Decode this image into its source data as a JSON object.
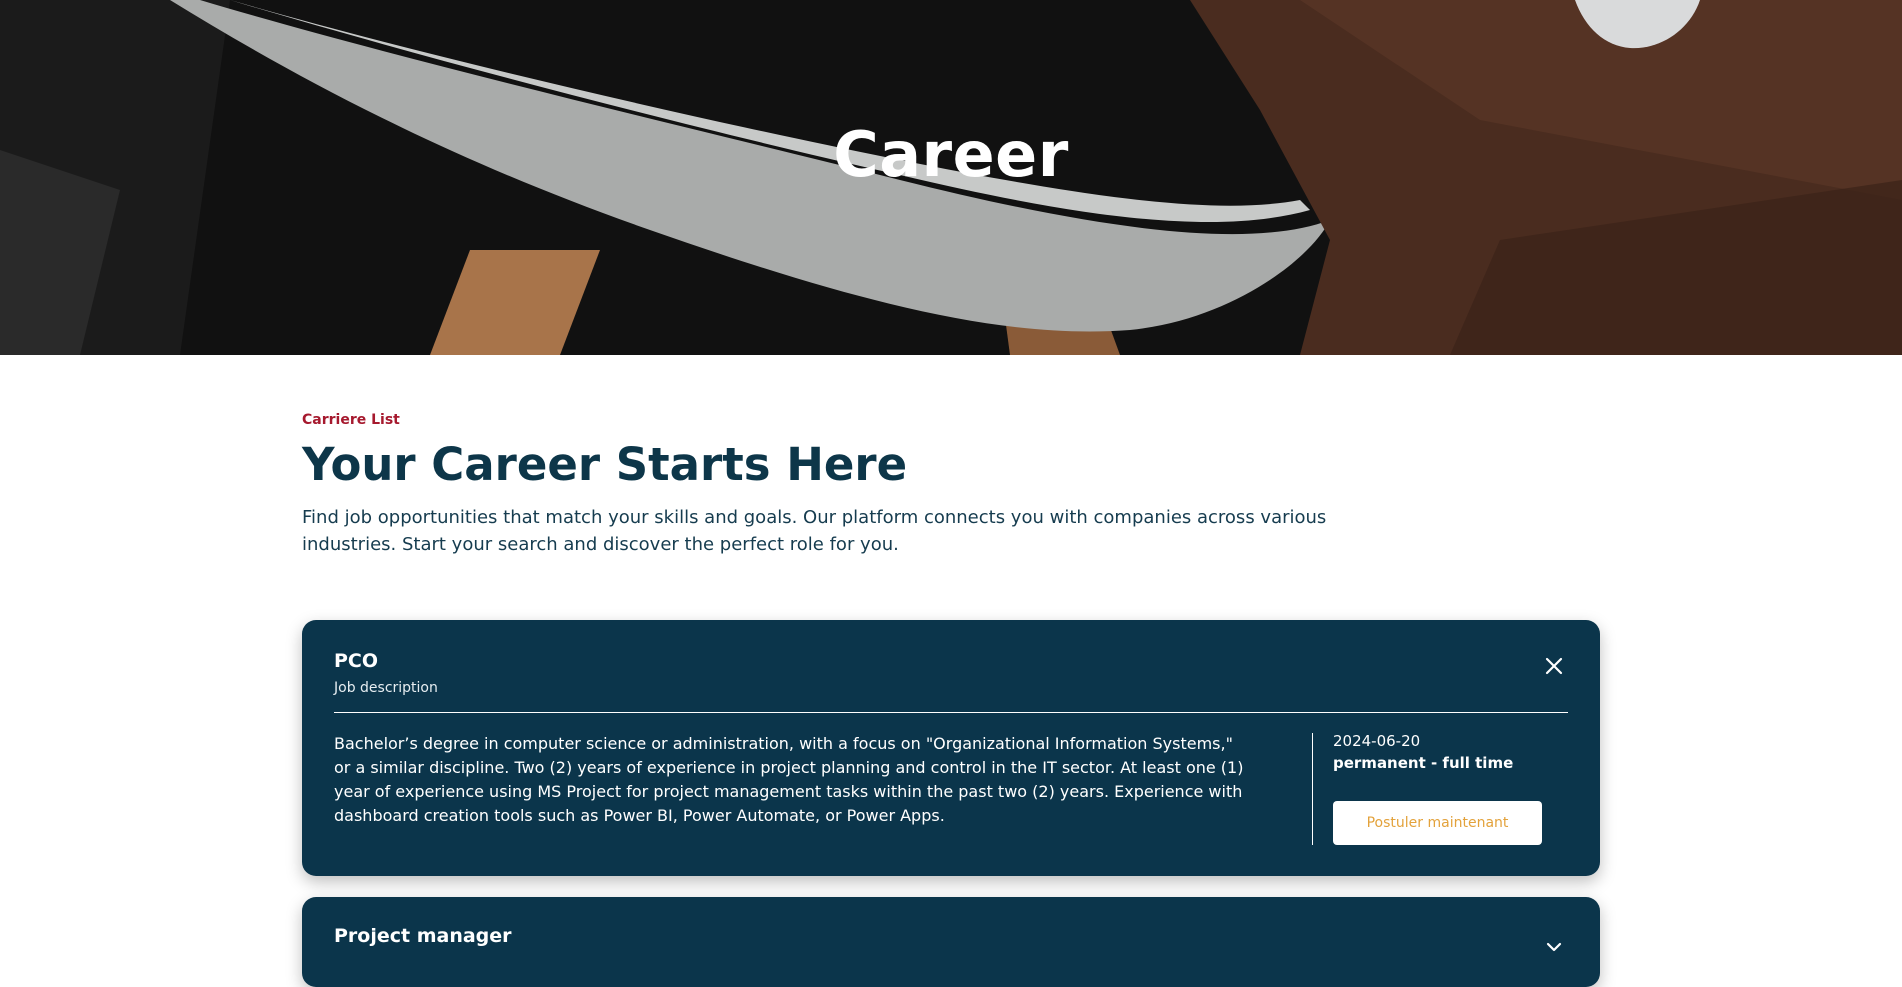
{
  "hero": {
    "title": "Career"
  },
  "section": {
    "eyebrow": "Carriere List",
    "heading": "Your Career Starts Here",
    "intro": "Find job opportunities that match your skills and goals. Our platform connects you with companies across various industries. Start your search and discover the perfect role for you."
  },
  "jobs": [
    {
      "title": "PCO",
      "subtitle": "Job description",
      "description": "Bachelor’s degree in computer science or administration, with a focus on \"Organizational Information Systems,\" or a similar discipline. Two (2) years of experience in project planning and control in the IT sector. At least one (1) year of experience using MS Project for project management tasks within the past two (2) years. Experience with dashboard creation tools such as Power BI, Power Automate, or Power Apps.",
      "date": "2024-06-20",
      "contract": "permanent - full time",
      "apply_label": "Postuler maintenant",
      "expanded": true,
      "toggle_icon": "close-icon"
    },
    {
      "title": "Project manager",
      "expanded": false,
      "toggle_icon": "chevron-down-icon"
    }
  ],
  "colors": {
    "accent_red": "#a6192e",
    "navy": "#0b354b",
    "heading": "#0d3649",
    "button_text": "#e3a23b"
  }
}
